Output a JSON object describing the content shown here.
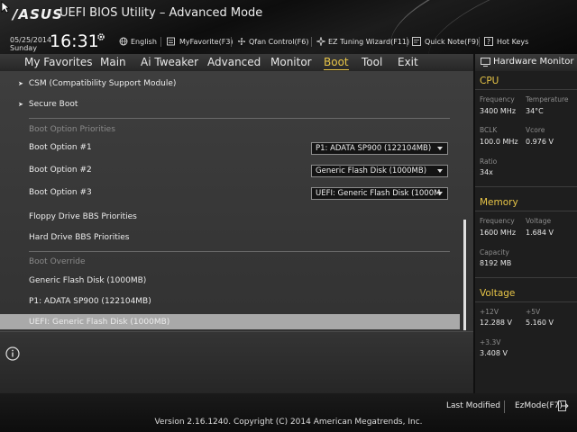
{
  "header": {
    "logo": "/ASUS",
    "title": "UEFI BIOS Utility – Advanced Mode",
    "date": "05/25/2014",
    "day": "Sunday",
    "time": "16:31"
  },
  "toolbar": {
    "language": "English",
    "myfavorite": "MyFavorite(F3)",
    "qfan": "Qfan Control(F6)",
    "ez_tuning": "EZ Tuning Wizard(F11)",
    "quick_note": "Quick Note(F9)",
    "hot_keys": "Hot Keys"
  },
  "menu": {
    "items": [
      "My Favorites",
      "Main",
      "Ai Tweaker",
      "Advanced",
      "Monitor",
      "Boot",
      "Tool",
      "Exit"
    ],
    "active": "Boot"
  },
  "boot": {
    "csm": "CSM (Compatibility Support Module)",
    "secure_boot": "Secure Boot",
    "priorities_header": "Boot Option Priorities",
    "options": [
      {
        "label": "Boot Option #1",
        "value": "P1: ADATA SP900  (122104MB)"
      },
      {
        "label": "Boot Option #2",
        "value": "Generic Flash Disk  (1000MB)"
      },
      {
        "label": "Boot Option #3",
        "value": "UEFI: Generic Flash Disk (1000M"
      }
    ],
    "floppy": "Floppy Drive BBS Priorities",
    "hard_drive": "Hard Drive BBS Priorities",
    "override_header": "Boot Override",
    "overrides": [
      "Generic Flash Disk  (1000MB)",
      "P1: ADATA SP900  (122104MB)",
      "UEFI: Generic Flash Disk (1000MB)"
    ]
  },
  "hw_monitor": {
    "title": "Hardware Monitor",
    "cpu": {
      "heading": "CPU",
      "frequency_label": "Frequency",
      "frequency": "3400 MHz",
      "temperature_label": "Temperature",
      "temperature": "34°C",
      "bclk_label": "BCLK",
      "bclk": "100.0 MHz",
      "vcore_label": "Vcore",
      "vcore": "0.976 V",
      "ratio_label": "Ratio",
      "ratio": "34x"
    },
    "memory": {
      "heading": "Memory",
      "frequency_label": "Frequency",
      "frequency": "1600 MHz",
      "voltage_label": "Voltage",
      "voltage": "1.684 V",
      "capacity_label": "Capacity",
      "capacity": "8192 MB"
    },
    "voltage": {
      "heading": "Voltage",
      "v12_label": "+12V",
      "v12": "12.288 V",
      "v5_label": "+5V",
      "v5": "5.160 V",
      "v33_label": "+3.3V",
      "v33": "3.408 V"
    }
  },
  "footer": {
    "last_modified": "Last Modified",
    "ezmode": "EzMode(F7)",
    "version": "Version 2.16.1240. Copyright (C) 2014 American Megatrends, Inc."
  },
  "colors": {
    "accent": "#e8c547",
    "selected_row": "#a9a9a9"
  }
}
